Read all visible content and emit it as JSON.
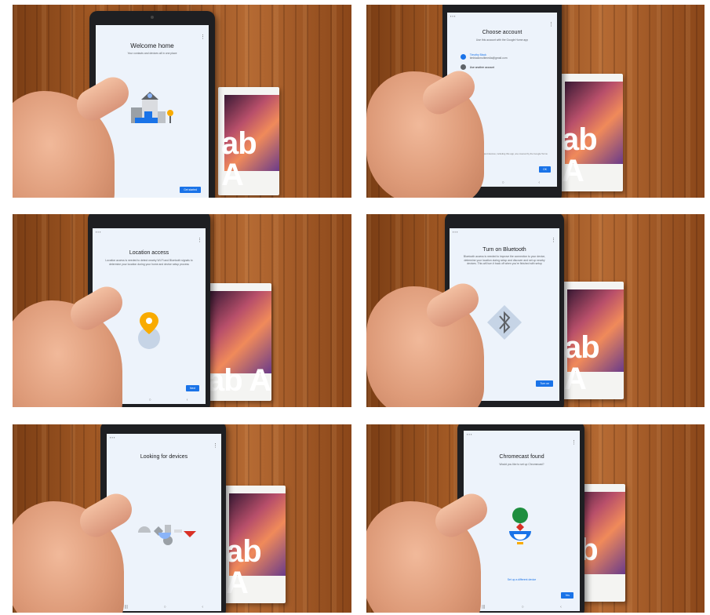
{
  "panels": [
    {
      "title": "Welcome home",
      "subtitle": "Your contacts and devices all in one place",
      "primary_button": "Get started",
      "illustration": "house-illustration"
    },
    {
      "title": "Choose account",
      "subtitle": "Use this account with the Google Home app",
      "accounts": [
        {
          "name": "Timothy Black",
          "email": "timblackmultimedia@gmail.com"
        },
        {
          "name": "Use another account",
          "email": ""
        }
      ],
      "footer": "Your use of Google services and devices, including this app, are covered by the Google Terms of Service and Privacy Policy",
      "primary_button": "OK"
    },
    {
      "title": "Location access",
      "subtitle": "Location access is needed to detect nearby Wi-Fi and Bluetooth signals to determine your location during your home and device setup process",
      "secondary_link": "Help",
      "primary_button": "Next",
      "illustration": "location-pin-illustration"
    },
    {
      "title": "Turn on Bluetooth",
      "subtitle": "Bluetooth access is needed to improve the connection to your device, determine your location during setup and discover and set up nearby devices. This will turn it back off when you're finished with setup",
      "secondary_link": "Cancel",
      "primary_button": "Turn on",
      "illustration": "bluetooth-illustration"
    },
    {
      "title": "Looking for devices",
      "subtitle": "",
      "secondary_link": "Cancel",
      "illustration": "shapes-illustration"
    },
    {
      "title": "Chromecast found",
      "subtitle": "Would you like to set up Chromecast?",
      "secondary_link": "Skip",
      "center_link": "Set up a different device",
      "primary_button": "Yes",
      "illustration": "chromecast-illustration"
    }
  ],
  "box_text": "ab A",
  "colors": {
    "accent": "#1a73e8",
    "screen_bg": "#edf3fb",
    "wood": "#a35a25",
    "google_green": "#1e8e3e",
    "google_red": "#d93025",
    "google_yellow": "#f9ab00"
  }
}
